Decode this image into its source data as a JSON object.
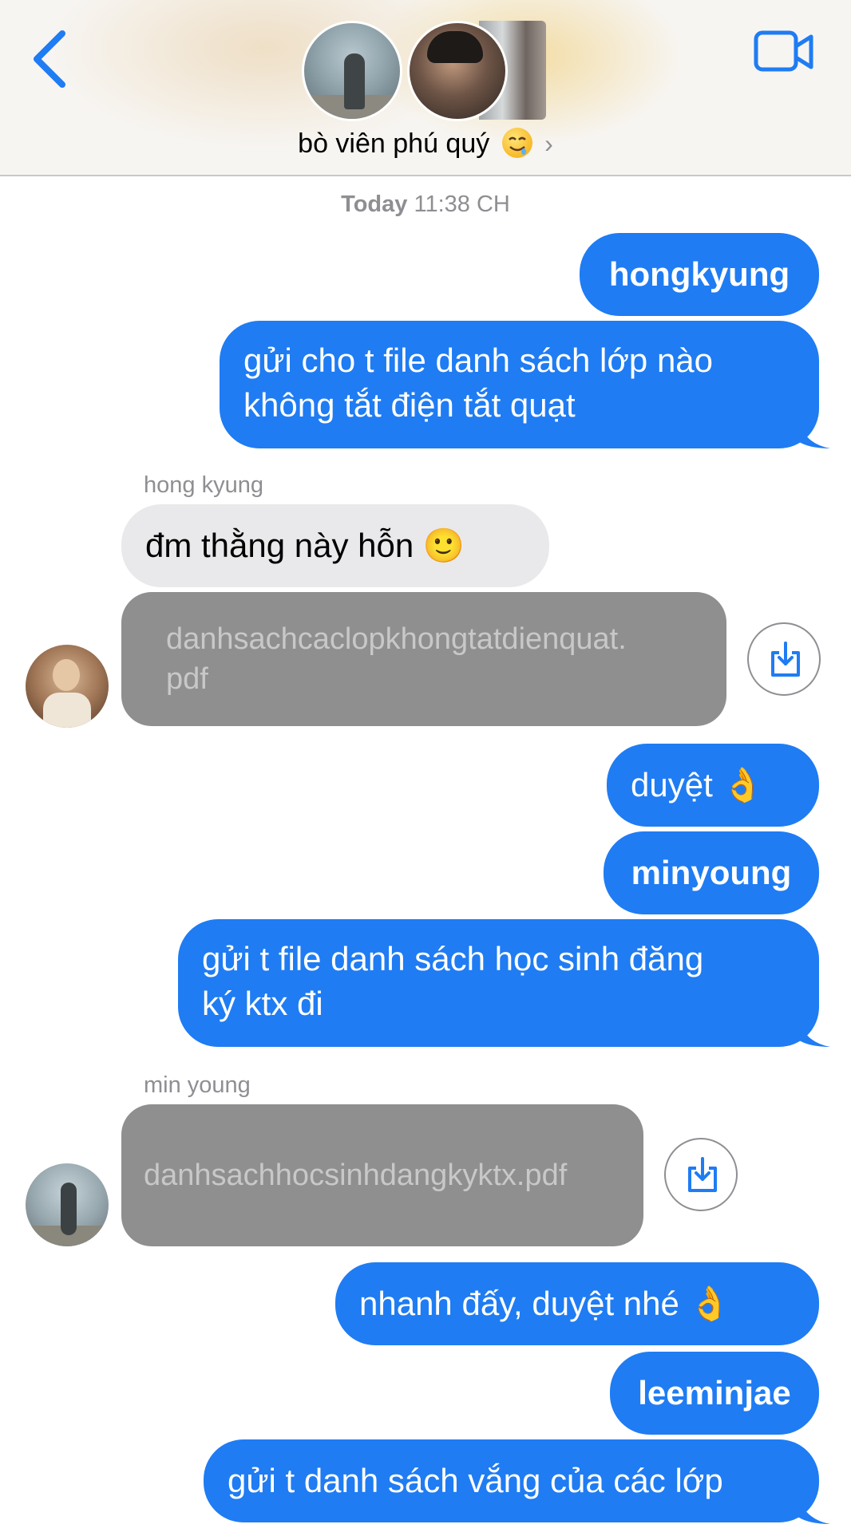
{
  "header": {
    "contact_name": "bò viên phú quý",
    "name_emoji": "drooling-face-emoji",
    "back_icon": "chevron-left-icon",
    "video_icon": "video-camera-icon",
    "accent_color": "#1f7cf3"
  },
  "thread": {
    "timestamp_day": "Today",
    "timestamp_time": "11:38 CH",
    "messages": [
      {
        "side": "out",
        "text": "hongkyung"
      },
      {
        "side": "out",
        "lines": [
          "gửi cho t file danh sách lớp nào",
          "không tắt điện tắt quạt"
        ]
      },
      {
        "side": "in",
        "sender": "hong kyung",
        "text": "đm thằng này hỗn 🙂"
      },
      {
        "side": "in",
        "type": "file",
        "lines": [
          "danhsachcaclopkhongtatdienquat.",
          "pdf"
        ]
      },
      {
        "side": "out",
        "text": "duyệt 👌"
      },
      {
        "side": "out",
        "text": "minyoung"
      },
      {
        "side": "out",
        "lines": [
          "gửi t file danh sách học sinh đăng",
          "ký ktx đi"
        ]
      },
      {
        "side": "in",
        "sender": "min young",
        "type": "file",
        "text": "danhsachhocsinhdangkyktx.pdf"
      },
      {
        "side": "out",
        "text": "nhanh đấy, duyệt nhé 👌"
      },
      {
        "side": "out",
        "text": "leeminjae"
      },
      {
        "side": "out",
        "text": "gửi t danh sách vắng của các lớp"
      }
    ]
  },
  "colors": {
    "outgoing_bubble": "#1f7cf3",
    "incoming_bubble": "#e9e9eb",
    "file_bubble": "#8f8f8f"
  }
}
